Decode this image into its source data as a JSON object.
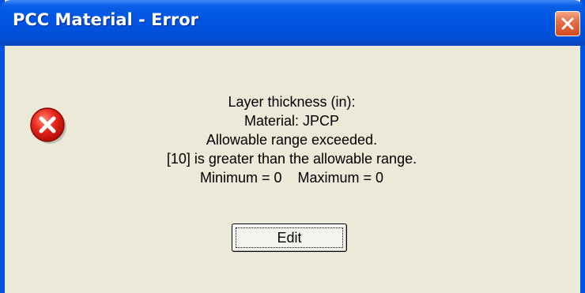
{
  "window": {
    "title": "PCC Material - Error",
    "close_icon": "close-icon",
    "colors": {
      "titlebar": "#0054e3",
      "close_button": "#d44a1e",
      "client_bg": "#ece9d8"
    }
  },
  "dialog": {
    "icon": "error-icon",
    "message_lines": [
      "Layer thickness (in):",
      "Material: JPCP",
      "Allowable range exceeded.",
      "[10] is greater than the allowable range.",
      "Minimum = 0    Maximum = 0"
    ],
    "edit_button_label": "Edit"
  }
}
